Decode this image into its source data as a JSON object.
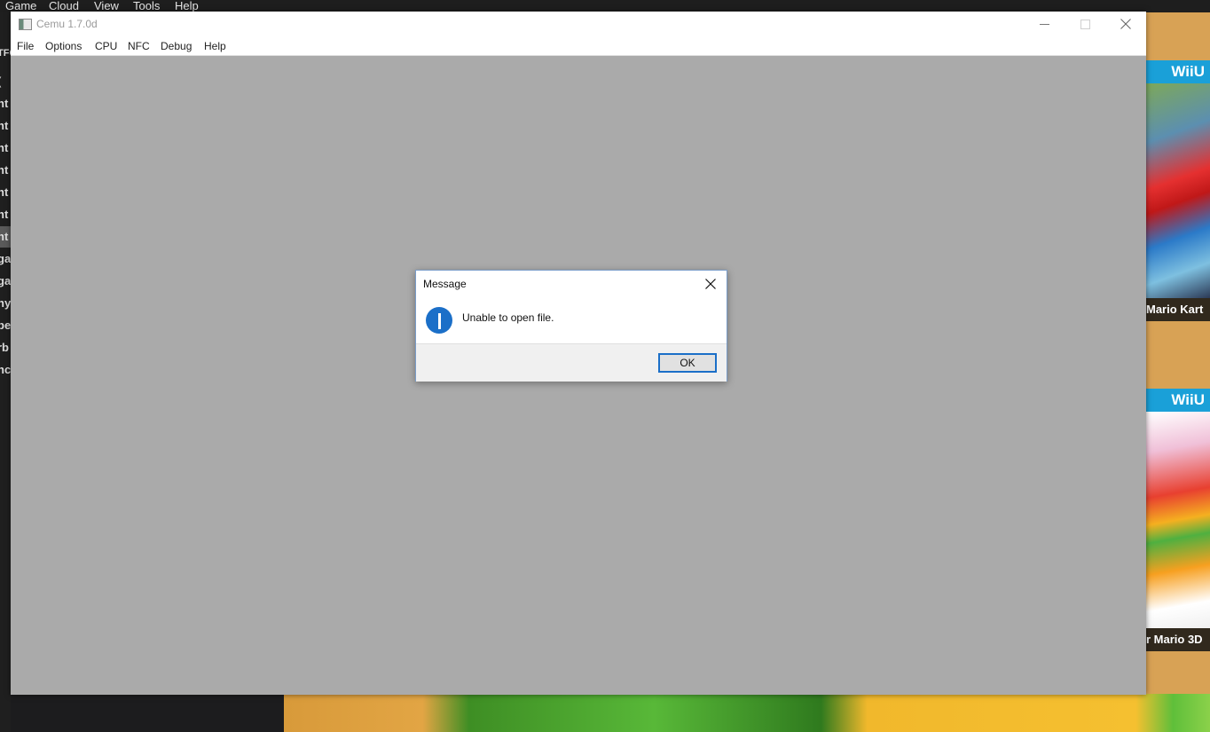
{
  "background": {
    "menubar": [
      "Game",
      "Cloud",
      "View",
      "Tools",
      "Help"
    ],
    "sidebar_fragments": [
      "TFC",
      "(",
      "nt",
      "nt",
      "nt",
      "nt",
      "nt",
      "nt",
      "nt",
      "ga",
      "ga",
      "ny",
      "pe",
      "rb",
      "nc"
    ],
    "sidebar_selected_index": 7,
    "covers": [
      {
        "badge": "WiiU",
        "title": "Mario Kart"
      },
      {
        "badge": "WiiU",
        "title": "r Mario 3D"
      }
    ]
  },
  "app_window": {
    "title": "Cemu 1.7.0d",
    "icon": "app-window-icon",
    "controls": {
      "minimize": "minimize-icon",
      "maximize": "maximize-icon",
      "close": "close-icon"
    },
    "menu": [
      "File",
      "Options",
      "CPU",
      "NFC",
      "Debug",
      "Help"
    ]
  },
  "dialog": {
    "title": "Message",
    "icon": "info-icon",
    "message": "Unable to open file.",
    "ok_label": "OK",
    "accent": "#1b6fc8"
  }
}
